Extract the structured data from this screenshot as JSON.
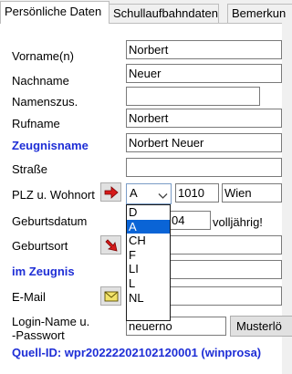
{
  "tabs": [
    "Persönliche Daten",
    "Schullaufbahndaten",
    "Bemerkun"
  ],
  "labels": {
    "vorname": "Vorname(n)",
    "nachname": "Nachname",
    "namenszus": "Namenszus.",
    "rufname": "Rufname",
    "zeugnisname": "Zeugnisname",
    "strasse": "Straße",
    "plz_wohnort": "PLZ u. Wohnort",
    "geburtsdatum": "Geburtsdatum",
    "geburtsort": "Geburtsort",
    "im_zeugnis": "im Zeugnis",
    "email": "E-Mail",
    "login_line1": "Login-Name u.",
    "login_line2": "-Passwort"
  },
  "fields": {
    "vorname": "Norbert",
    "nachname": "Neuer",
    "namenszus": "",
    "rufname": "Norbert",
    "zeugnisname": "Norbert Neuer",
    "strasse": "",
    "plz": "1010",
    "wohnort": "Wien",
    "geburtsdatum_visible": "04",
    "login_name": "neuerno"
  },
  "country_select": {
    "value": "A",
    "options": [
      "D",
      "A",
      "CH",
      "F",
      "LI",
      "L",
      "NL"
    ],
    "selected_index": 1
  },
  "checkbox_label": "volljährig!",
  "buttons": {
    "muster": "Musterlö"
  },
  "footer": "Quell-ID: wpr20222202102120001  (winprosa)",
  "icons": [
    "arrow-right-icon",
    "arrow-down-right-icon",
    "envelope-icon",
    "chevron-down-icon"
  ],
  "colors": {
    "label_blue": "#1e2ed6",
    "icon_red": "#d61a1a",
    "selection_blue": "#0a64d6"
  }
}
